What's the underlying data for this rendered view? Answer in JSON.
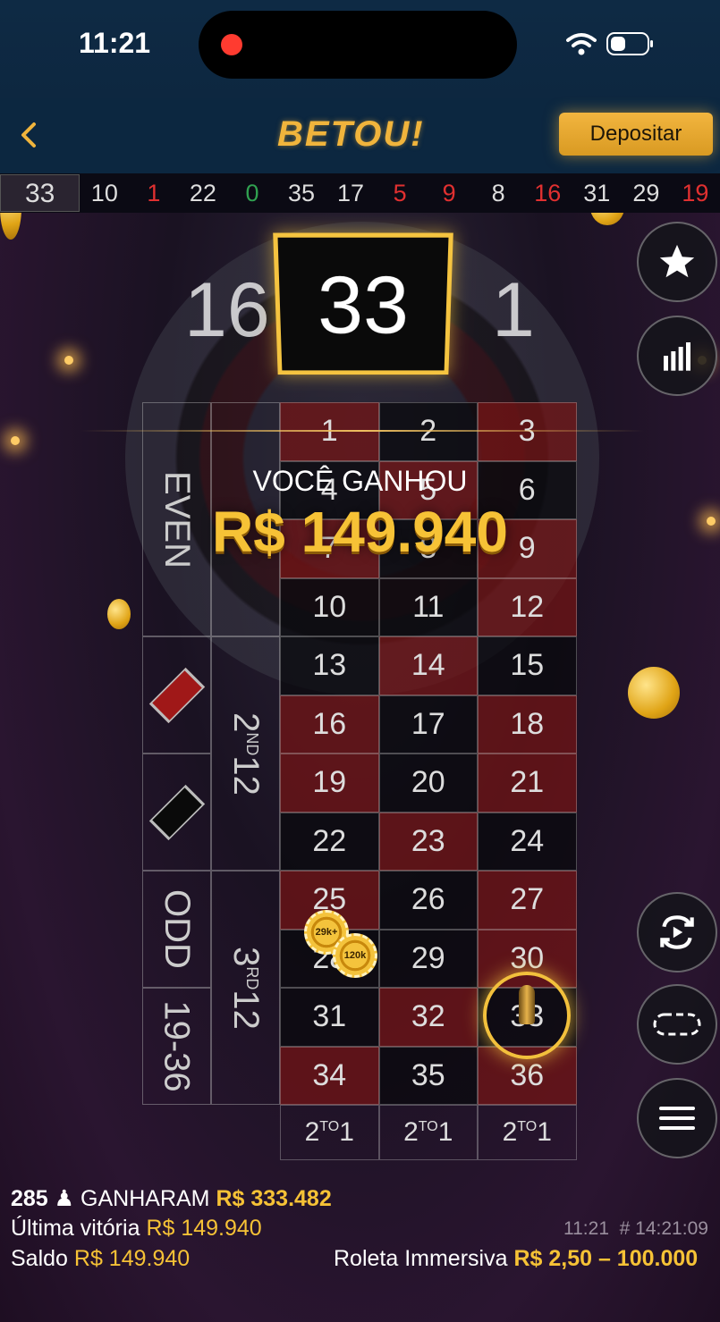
{
  "status": {
    "time": "11:21"
  },
  "header": {
    "logo": "BETOU!",
    "deposit_label": "Depositar"
  },
  "history": [
    {
      "n": "33",
      "c": "black"
    },
    {
      "n": "10",
      "c": "black"
    },
    {
      "n": "1",
      "c": "red"
    },
    {
      "n": "22",
      "c": "black"
    },
    {
      "n": "0",
      "c": "green"
    },
    {
      "n": "35",
      "c": "black"
    },
    {
      "n": "17",
      "c": "black"
    },
    {
      "n": "5",
      "c": "red"
    },
    {
      "n": "9",
      "c": "red"
    },
    {
      "n": "8",
      "c": "black"
    },
    {
      "n": "16",
      "c": "red"
    },
    {
      "n": "31",
      "c": "black"
    },
    {
      "n": "29",
      "c": "black"
    },
    {
      "n": "19",
      "c": "red"
    }
  ],
  "result": {
    "number": "33",
    "prev_number": "16",
    "next_number": "1"
  },
  "win": {
    "label": "VOCÊ GANHOU",
    "amount": "R$ 149.940"
  },
  "table": {
    "numbers": [
      {
        "n": "1",
        "c": "red"
      },
      {
        "n": "2",
        "c": "black"
      },
      {
        "n": "3",
        "c": "red"
      },
      {
        "n": "4",
        "c": "black"
      },
      {
        "n": "5",
        "c": "red"
      },
      {
        "n": "6",
        "c": "black"
      },
      {
        "n": "7",
        "c": "red"
      },
      {
        "n": "8",
        "c": "black"
      },
      {
        "n": "9",
        "c": "red"
      },
      {
        "n": "10",
        "c": "black"
      },
      {
        "n": "11",
        "c": "black"
      },
      {
        "n": "12",
        "c": "red"
      },
      {
        "n": "13",
        "c": "black"
      },
      {
        "n": "14",
        "c": "red"
      },
      {
        "n": "15",
        "c": "black"
      },
      {
        "n": "16",
        "c": "red"
      },
      {
        "n": "17",
        "c": "black"
      },
      {
        "n": "18",
        "c": "red"
      },
      {
        "n": "19",
        "c": "red"
      },
      {
        "n": "20",
        "c": "black"
      },
      {
        "n": "21",
        "c": "red"
      },
      {
        "n": "22",
        "c": "black"
      },
      {
        "n": "23",
        "c": "red"
      },
      {
        "n": "24",
        "c": "black"
      },
      {
        "n": "25",
        "c": "red"
      },
      {
        "n": "26",
        "c": "black"
      },
      {
        "n": "27",
        "c": "red"
      },
      {
        "n": "28",
        "c": "black"
      },
      {
        "n": "29",
        "c": "black"
      },
      {
        "n": "30",
        "c": "red"
      },
      {
        "n": "31",
        "c": "black"
      },
      {
        "n": "32",
        "c": "red"
      },
      {
        "n": "33",
        "c": "black"
      },
      {
        "n": "34",
        "c": "red"
      },
      {
        "n": "35",
        "c": "black"
      },
      {
        "n": "36",
        "c": "red"
      }
    ],
    "even_label": "EVEN",
    "odd_label": "ODD",
    "high_label": "19-36",
    "dozen2": {
      "base": "2",
      "sup": "ND",
      "num": "12"
    },
    "dozen3": {
      "base": "3",
      "sup": "RD",
      "num": "12"
    },
    "column_label": {
      "base": "2",
      "sup": "TO",
      "num": "1"
    },
    "chips": [
      {
        "label": "29k+"
      },
      {
        "label": "120k"
      }
    ]
  },
  "footer": {
    "players_count": "285",
    "players_label": "GANHARAM",
    "players_amount": "R$ 333.482",
    "last_win_label": "Última vitória",
    "last_win_amount": "R$ 149.940",
    "time": "11:21",
    "round_id": "# 14:21:09",
    "balance_label": "Saldo",
    "balance_amount": "R$ 149.940",
    "game_name": "Roleta Immersiva",
    "limits": "R$ 2,50 – 100.000"
  },
  "colors": {
    "accent": "#f6c236",
    "red_cell": "#781414",
    "header_bg": "#0c2740"
  }
}
